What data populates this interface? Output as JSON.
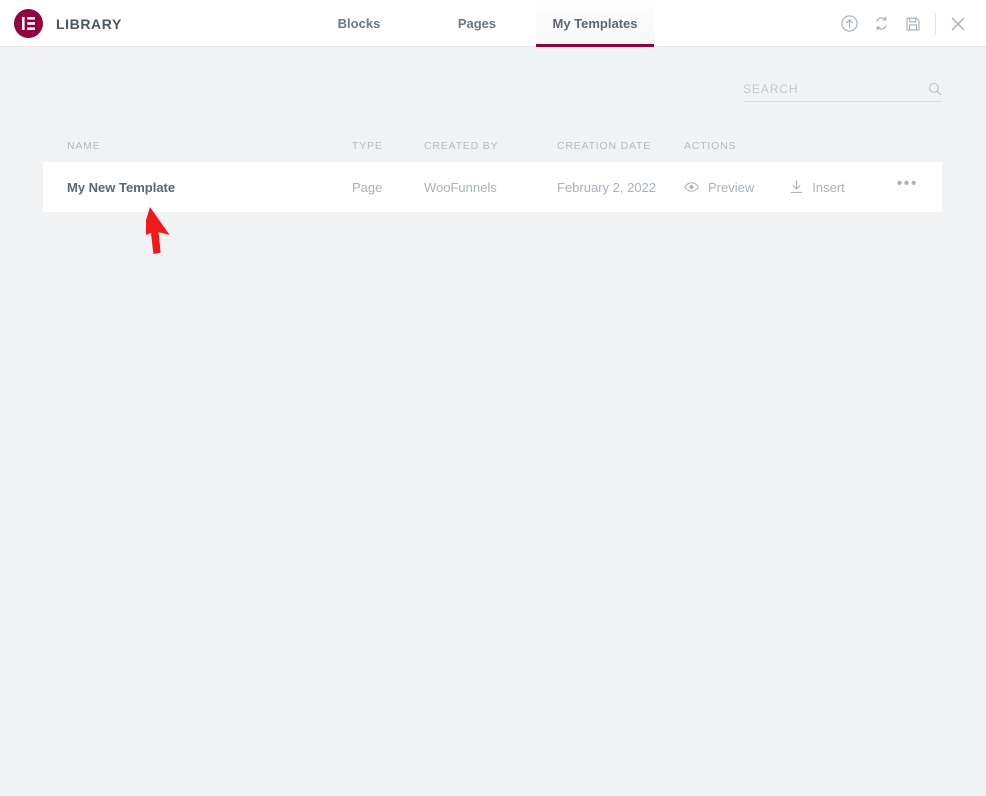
{
  "header": {
    "logo_icon": "elementor-logo-icon",
    "title": "LIBRARY",
    "brand_color": "#93003f",
    "tabs": [
      {
        "label": "Blocks",
        "active": false
      },
      {
        "label": "Pages",
        "active": false
      },
      {
        "label": "My Templates",
        "active": true
      }
    ],
    "actions": [
      {
        "name": "import-template-button",
        "icon": "upload-circle-icon"
      },
      {
        "name": "sync-library-button",
        "icon": "sync-icon"
      },
      {
        "name": "save-template-button",
        "icon": "save-floppy-icon"
      },
      {
        "name": "close-library-button",
        "icon": "close-icon"
      }
    ]
  },
  "search": {
    "placeholder": "SEARCH",
    "value": "",
    "icon": "search-icon"
  },
  "table": {
    "columns": [
      {
        "key": "name",
        "label": "NAME"
      },
      {
        "key": "type",
        "label": "TYPE"
      },
      {
        "key": "created_by",
        "label": "CREATED BY"
      },
      {
        "key": "creation_date",
        "label": "CREATION DATE"
      },
      {
        "key": "actions",
        "label": "ACTIONS"
      }
    ],
    "rows": [
      {
        "name": "My New Template",
        "type": "Page",
        "created_by": "WooFunnels",
        "creation_date": "February 2, 2022",
        "preview_label": "Preview",
        "insert_label": "Insert",
        "more_label": "•••"
      }
    ]
  },
  "annotation": {
    "type": "arrow-cursor",
    "color": "#f01a1a"
  }
}
